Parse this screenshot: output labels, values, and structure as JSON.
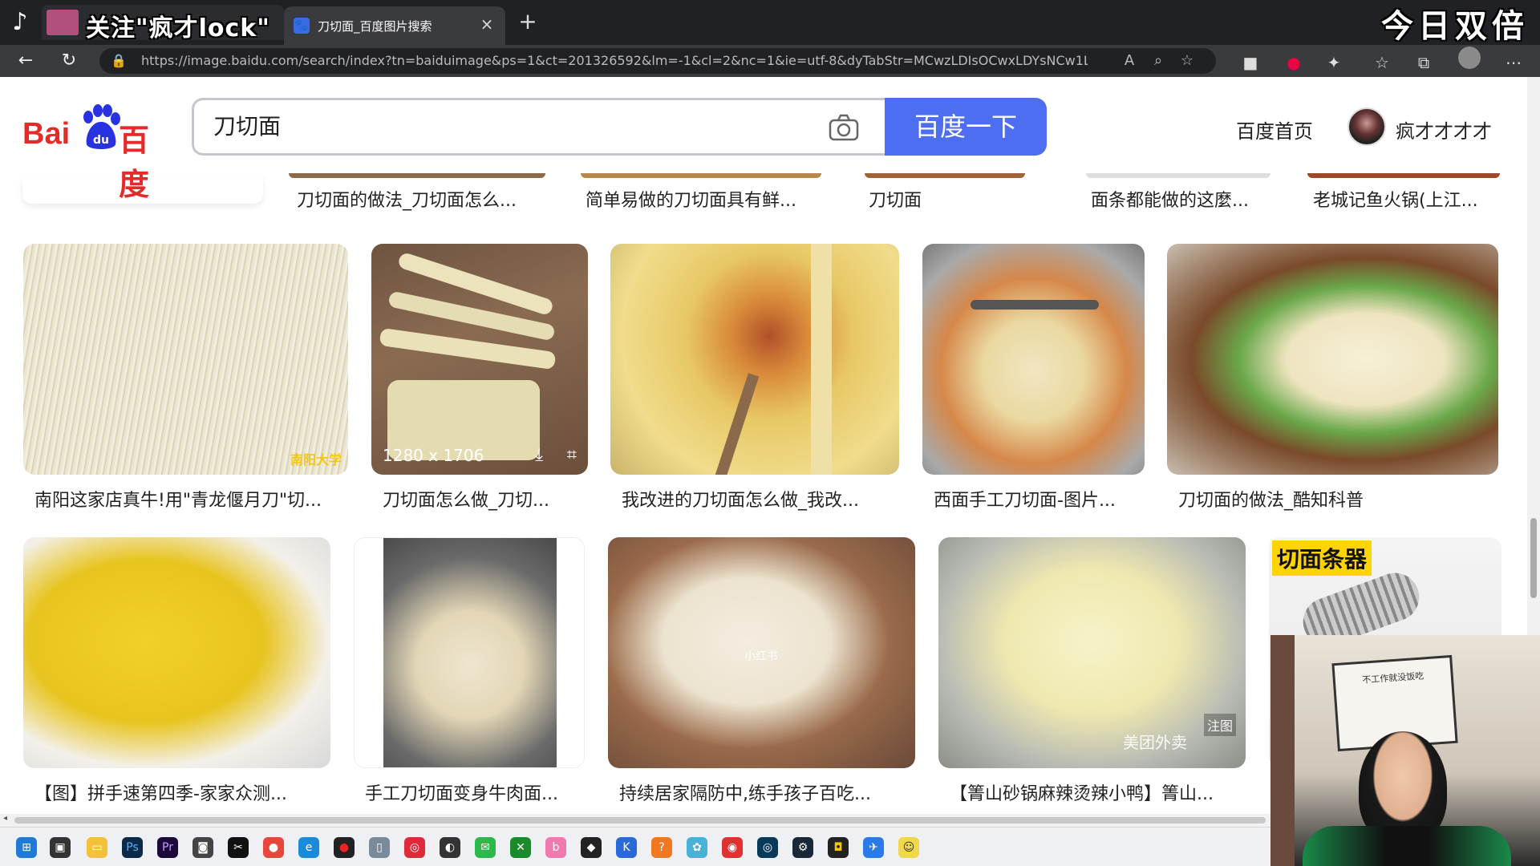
{
  "tabs": {
    "overlay_caption": "关注\"疯才lock\"",
    "active_title": "刀切面_百度图片搜索",
    "active_favicon": "paw-icon",
    "close_glyph": "×",
    "new_tab_glyph": "+"
  },
  "stream_overlay": {
    "corner_title": "今日双倍"
  },
  "address_bar": {
    "url": "https://image.baidu.com/search/index?tn=baiduimage&ps=1&ct=201326592&lm=-1&cl=2&nc=1&ie=utf-8&dyTabStr=MCwzLDIsOCwxLDYsNCw1LDcsO..."
  },
  "header": {
    "logo_left": "Bai",
    "logo_right": "百度",
    "search_query": "刀切面",
    "search_button": "百度一下",
    "home_link": "百度首页",
    "user_name": "疯才才才才"
  },
  "prev_row_captions": [
    "刀切面的做法_刀切面怎么...",
    "简单易做的刀切面具有鲜...",
    "刀切面",
    "面条都能做的这麼...",
    "老城记鱼火锅(上江..."
  ],
  "row1": [
    {
      "caption": "南阳这家店真牛!用\"青龙偃月刀\"切...",
      "stamp": "南阳大学"
    },
    {
      "caption": "刀切面怎么做_刀切...",
      "dims": "1280 x 1706"
    },
    {
      "caption": "我改进的刀切面怎么做_我改..."
    },
    {
      "caption": "西面手工刀切面-图片..."
    },
    {
      "caption": "刀切面的做法_酷知科普"
    }
  ],
  "row2": [
    {
      "caption": "【图】拼手速第四季-家家众测..."
    },
    {
      "caption": "手工刀切面变身牛肉面..."
    },
    {
      "caption": "持续居家隔防中,练手孩子百吃...",
      "stamp": "小红书"
    },
    {
      "caption": "【箐山砂锅麻辣烫辣小鸭】箐山...",
      "stamp": "美团外卖",
      "stamp2": "注图"
    },
    {
      "caption": "",
      "badge": "切面条器"
    }
  ],
  "webcam": {
    "sign": "不工作就没饭吃"
  },
  "colors": {
    "brand_red": "#e62a2a",
    "brand_blue": "#4e6ef2",
    "tab_dark": "#202124"
  }
}
